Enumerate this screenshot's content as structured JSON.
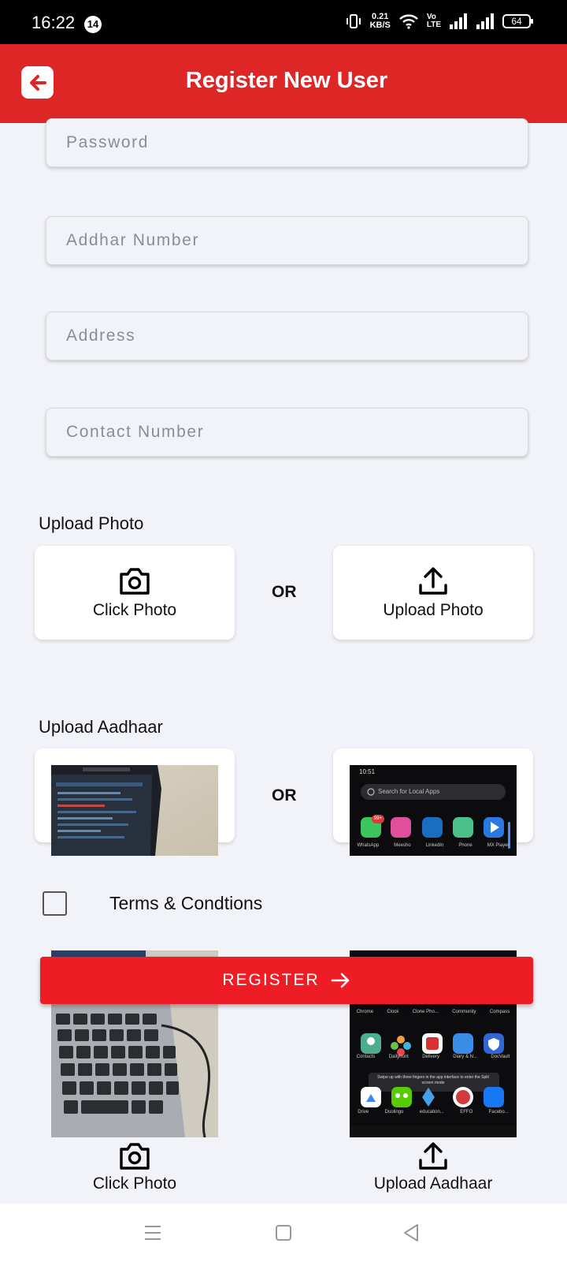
{
  "status_bar": {
    "time": "16:22",
    "notification_count": "14",
    "net_speed_value": "0.21",
    "net_speed_unit": "KB/S",
    "volte_top": "Vo",
    "volte_bottom": "LTE",
    "battery": "64"
  },
  "app_bar": {
    "title": "Register New User",
    "back_icon": "back-arrow-icon"
  },
  "form": {
    "password_placeholder": "Password",
    "aadhar_placeholder": "Addhar Number",
    "address_placeholder": "Address",
    "contact_placeholder": "Contact Number"
  },
  "upload_photo": {
    "section_label": "Upload Photo",
    "click_label": "Click Photo",
    "or_label": "OR",
    "upload_label": "Upload Photo"
  },
  "upload_aadhaar": {
    "section_label": "Upload Aadhaar",
    "or_label": "OR"
  },
  "aadhaar_thumb_screenshot": {
    "time": "10:51",
    "search_placeholder": "Search for Local Apps",
    "apps_row1": [
      "WhatsApp",
      "Meesho",
      "LinkedIn",
      "Phone",
      "MX Player"
    ],
    "whatsapp_badge": "99+",
    "apps_row2": [
      "Chrome",
      "Clock",
      "Clone Pho...",
      "Community",
      "Compass"
    ],
    "apps_row3": [
      "Contacts",
      "Dailyhunt",
      "Delivery",
      "Diary & N...",
      "DocVault"
    ],
    "hint": "Swipe up with three fingers in the app interface to enter the Split screen mode",
    "apps_row4": [
      "Drive",
      "Duolingo",
      "education...",
      "EFFO",
      "Facebo..."
    ]
  },
  "terms": {
    "label": "Terms & Condtions",
    "checked": false
  },
  "register": {
    "label": "REGISTER",
    "icon": "arrow-right-icon"
  },
  "bottom_actions": {
    "click_photo": "Click Photo",
    "upload_aadhaar": "Upload Aadhaar"
  },
  "colors": {
    "app_bar": "#de2627",
    "register_button": "#ee1c25",
    "background": "#f2f3f8"
  }
}
